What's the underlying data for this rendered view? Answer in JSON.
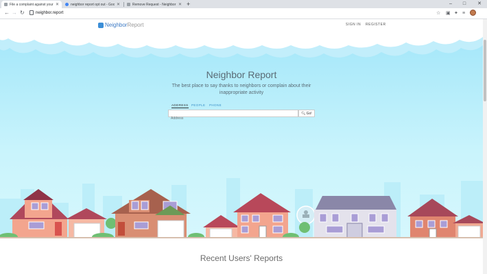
{
  "browser": {
    "tabs": [
      {
        "title": "File a complaint against your ne",
        "active": true,
        "favicon_color": "#9aa0a6"
      },
      {
        "title": "neighbor report opt out - Googl",
        "active": false,
        "favicon_color": "#4285f4"
      },
      {
        "title": "Remove Request - Neighbor rep",
        "active": false,
        "favicon_color": "#9aa0a6"
      }
    ],
    "new_tab": "+",
    "window_controls": {
      "minimize": "–",
      "maximize": "□",
      "close": "✕"
    },
    "url": "neighbor.report"
  },
  "site": {
    "brand_neighbor": "Neighbor",
    "brand_report": "Report",
    "nav": {
      "signin": "SIGN IN",
      "register": "REGISTER"
    }
  },
  "hero": {
    "title": "Neighbor Report",
    "subtitle": "The best place to say thanks to neighbors or complain about their inappropriate activity"
  },
  "search": {
    "tabs": {
      "address": "ADDRESS",
      "people": "PEOPLE",
      "phone": "PHONE"
    },
    "placeholder": "Address",
    "go_label": "Go!"
  },
  "recent": {
    "title": "Recent Users' Reports"
  },
  "colors": {
    "sky": "#9fe5f9",
    "brand": "#3b79c4",
    "tab_link": "#3a8fc9"
  }
}
